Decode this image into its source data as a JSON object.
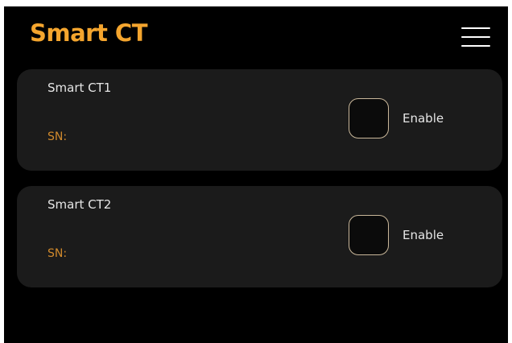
{
  "header": {
    "title": "Smart CT",
    "menu_icon": "hamburger-menu-icon"
  },
  "devices": [
    {
      "name": "Smart CT1",
      "sn_label": "SN:",
      "enable_label": "Enable",
      "enabled": false
    },
    {
      "name": "Smart CT2",
      "sn_label": "SN:",
      "enable_label": "Enable",
      "enabled": false
    }
  ],
  "colors": {
    "accent": "#f4a52e",
    "sn_text": "#d18a2c",
    "card_bg": "#1b1b1b",
    "background": "#000000"
  }
}
